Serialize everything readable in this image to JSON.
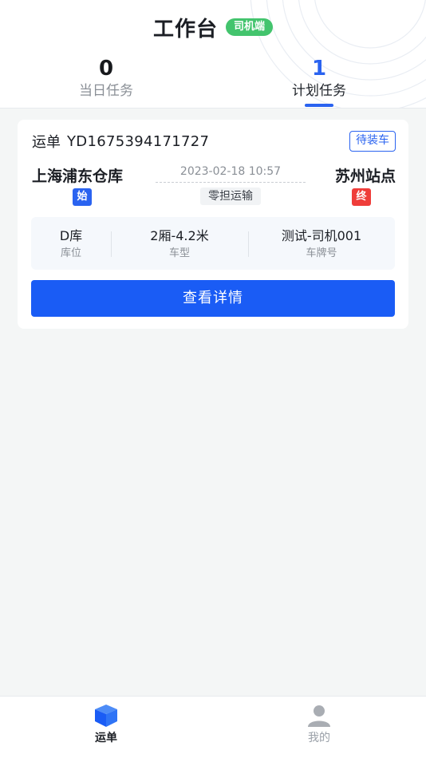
{
  "header": {
    "title": "工作台",
    "role_badge": "司机端"
  },
  "tabs": [
    {
      "count": "0",
      "label": "当日任务",
      "active": false
    },
    {
      "count": "1",
      "label": "计划任务",
      "active": true
    }
  ],
  "order": {
    "label": "运单",
    "number": "YD1675394171727",
    "status": "待装车",
    "from": "上海浦东仓库",
    "from_tag": "始",
    "to": "苏州站点",
    "to_tag": "终",
    "datetime": "2023-02-18 10:57",
    "transport_type": "零担运输",
    "info": [
      {
        "value": "D库",
        "label": "库位"
      },
      {
        "value": "2厢-4.2米",
        "label": "车型"
      },
      {
        "value": "测试-司机001",
        "label": "车牌号"
      }
    ],
    "detail_button": "查看详情"
  },
  "bottom_nav": [
    {
      "label": "运单",
      "icon": "box-icon",
      "active": true
    },
    {
      "label": "我的",
      "icon": "user-icon",
      "active": false
    }
  ],
  "colors": {
    "accent": "#2a63f0",
    "button": "#1a5cf5",
    "badge_green": "#43c46d",
    "end_red": "#ef3d3a"
  }
}
